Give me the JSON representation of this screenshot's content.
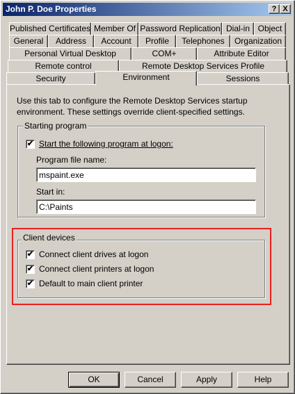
{
  "window": {
    "title": "John P. Doe Properties",
    "help_glyph": "?",
    "close_glyph": "X",
    "close_icon": "close-icon"
  },
  "tabs": {
    "row1": [
      "Published Certificates",
      "Member Of",
      "Password Replication",
      "Dial-in",
      "Object"
    ],
    "row2": [
      "General",
      "Address",
      "Account",
      "Profile",
      "Telephones",
      "Organization"
    ],
    "row3": [
      "Personal Virtual Desktop",
      "COM+",
      "Attribute Editor"
    ],
    "row4": [
      "Remote control",
      "Remote Desktop Services Profile"
    ],
    "row5": [
      "Security",
      "Environment",
      "Sessions"
    ],
    "active": "Environment"
  },
  "environment": {
    "description": "Use this tab to configure the Remote Desktop Services startup environment. These settings override client-specified settings.",
    "starting_program": {
      "group_label": "Starting program",
      "start_program_checkbox": {
        "label": "Start the following program at logon:",
        "checked": true
      },
      "program_file_label": "Program file name:",
      "program_file_value": "mspaint.exe",
      "start_in_label": "Start in:",
      "start_in_value": "C:\\Paints"
    },
    "client_devices": {
      "group_label": "Client devices",
      "items": [
        {
          "label": "Connect client drives at logon",
          "checked": true
        },
        {
          "label": "Connect client printers at logon",
          "checked": true
        },
        {
          "label": "Default to main client printer",
          "checked": true
        }
      ]
    },
    "check_glyph": "✔"
  },
  "buttons": {
    "ok": "OK",
    "cancel": "Cancel",
    "apply": "Apply",
    "help": "Help"
  },
  "colors": {
    "highlight_border": "#e8201f",
    "titlebar_start": "#0a246a",
    "titlebar_end": "#a6caf0"
  }
}
